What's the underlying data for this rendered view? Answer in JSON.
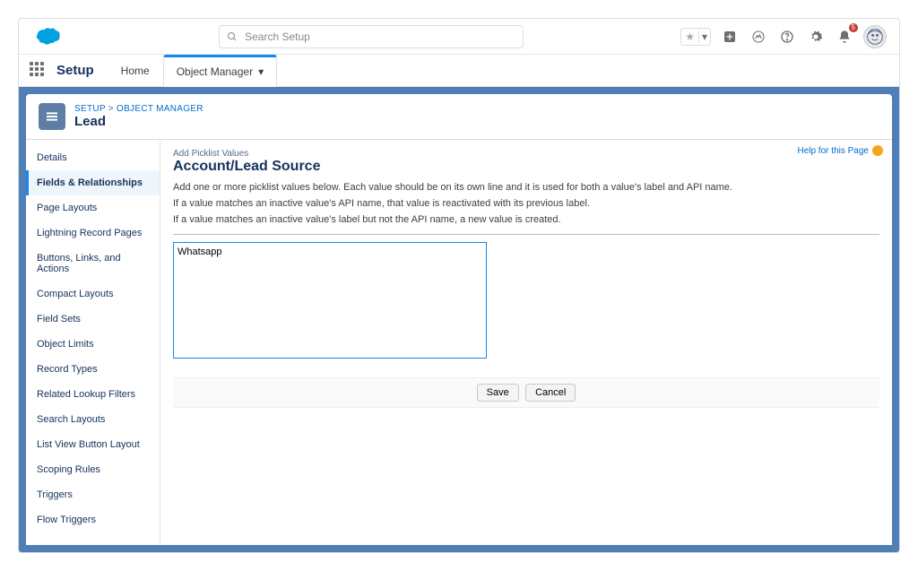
{
  "topbar": {
    "search_placeholder": "Search Setup",
    "notification_count": "5"
  },
  "appbar": {
    "app_name": "Setup",
    "tabs": [
      {
        "label": "Home",
        "active": false
      },
      {
        "label": "Object Manager",
        "active": true
      }
    ]
  },
  "breadcrumb": {
    "root": "SETUP",
    "sep": ">",
    "current": "OBJECT MANAGER"
  },
  "page_title": "Lead",
  "sidebar": {
    "items": [
      "Details",
      "Fields & Relationships",
      "Page Layouts",
      "Lightning Record Pages",
      "Buttons, Links, and Actions",
      "Compact Layouts",
      "Field Sets",
      "Object Limits",
      "Record Types",
      "Related Lookup Filters",
      "Search Layouts",
      "List View Button Layout",
      "Scoping Rules",
      "Triggers",
      "Flow Triggers"
    ],
    "active_index": 1
  },
  "main": {
    "eyebrow": "Add Picklist Values",
    "heading": "Account/Lead Source",
    "help_label": "Help for this Page",
    "desc1": "Add one or more picklist values below. Each value should be on its own line and it is used for both a value's label and API name.",
    "desc2": "If a value matches an inactive value's API name, that value is reactivated with its previous label.",
    "desc3": "If a value matches an inactive value's label but not the API name, a new value is created.",
    "textarea_value": "Whatsapp",
    "save_label": "Save",
    "cancel_label": "Cancel"
  }
}
